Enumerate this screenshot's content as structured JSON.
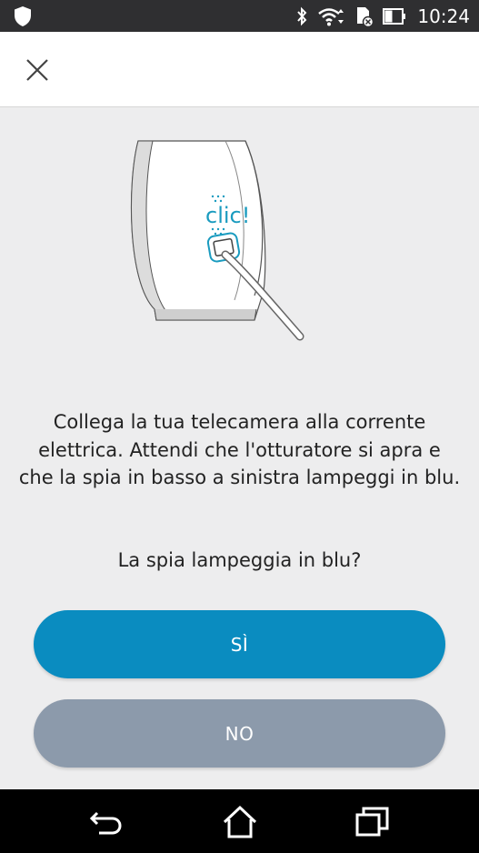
{
  "status_bar": {
    "time": "10:24",
    "icons": [
      "shield-icon",
      "bluetooth-icon",
      "wifi-icon",
      "sd-card-icon",
      "battery-icon"
    ]
  },
  "app_bar": {
    "close_icon": "close-icon"
  },
  "illustration": {
    "click_label": "clic!"
  },
  "content": {
    "instructions": "Collega la tua telecamera alla corrente elettrica. Attendi che l'otturatore si apra e che la spia in basso a sinistra lampeggi in blu.",
    "question": "La spia lampeggia in blu?"
  },
  "buttons": {
    "yes_label": "SÌ",
    "no_label": "NO"
  },
  "colors": {
    "primary": "#0a8cc0",
    "secondary": "#8c9aab",
    "background": "#ededee",
    "illustration_accent": "#1a9bbf"
  },
  "nav_bar": {
    "icons": [
      "back-icon",
      "home-icon",
      "recent-apps-icon"
    ]
  }
}
